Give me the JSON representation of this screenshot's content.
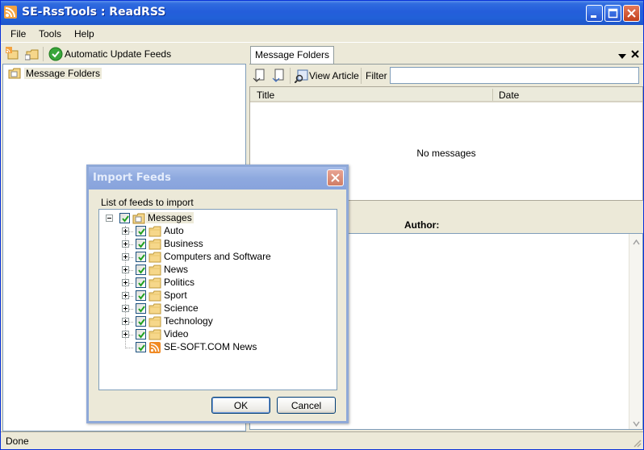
{
  "window": {
    "title": "SE-RssTools : ReadRSS",
    "minimize_label": "minimize",
    "maximize_label": "maximize",
    "close_label": "close"
  },
  "menu": {
    "items": [
      {
        "label": "File"
      },
      {
        "label": "Tools"
      },
      {
        "label": "Help"
      }
    ]
  },
  "left_toolbar": {
    "auto_update_label": "Automatic Update Feeds"
  },
  "left_tree": {
    "root_label": "Message Folders"
  },
  "right_pane": {
    "tab_label": "Message Folders",
    "view_article_label": "View Article",
    "filter_label": "Filter",
    "filter_value": "",
    "columns": [
      "Title",
      "Date"
    ],
    "empty_text": "No messages",
    "author_label": "Author:"
  },
  "status": {
    "text": "Done"
  },
  "dialog": {
    "title": "Import Feeds",
    "list_label": "List of feeds to import",
    "root": {
      "label": "Messages",
      "checked": true
    },
    "children": [
      {
        "label": "Auto",
        "type": "folder",
        "checked": true
      },
      {
        "label": "Business",
        "type": "folder",
        "checked": true
      },
      {
        "label": "Computers and Software",
        "type": "folder",
        "checked": true
      },
      {
        "label": "News",
        "type": "folder",
        "checked": true
      },
      {
        "label": "Politics",
        "type": "folder",
        "checked": true
      },
      {
        "label": "Sport",
        "type": "folder",
        "checked": true
      },
      {
        "label": "Science",
        "type": "folder",
        "checked": true
      },
      {
        "label": "Technology",
        "type": "folder",
        "checked": true
      },
      {
        "label": "Video",
        "type": "folder",
        "checked": true
      },
      {
        "label": "SE-SOFT.COM News",
        "type": "feed",
        "checked": true
      }
    ],
    "ok_label": "OK",
    "cancel_label": "Cancel"
  },
  "colors": {
    "titlebar": "#245edb",
    "dialog_titlebar": "#8ea9df",
    "face": "#ece9d8",
    "border": "#7f9db9",
    "feed_icon": "#f08a24",
    "check": "#21a121"
  }
}
